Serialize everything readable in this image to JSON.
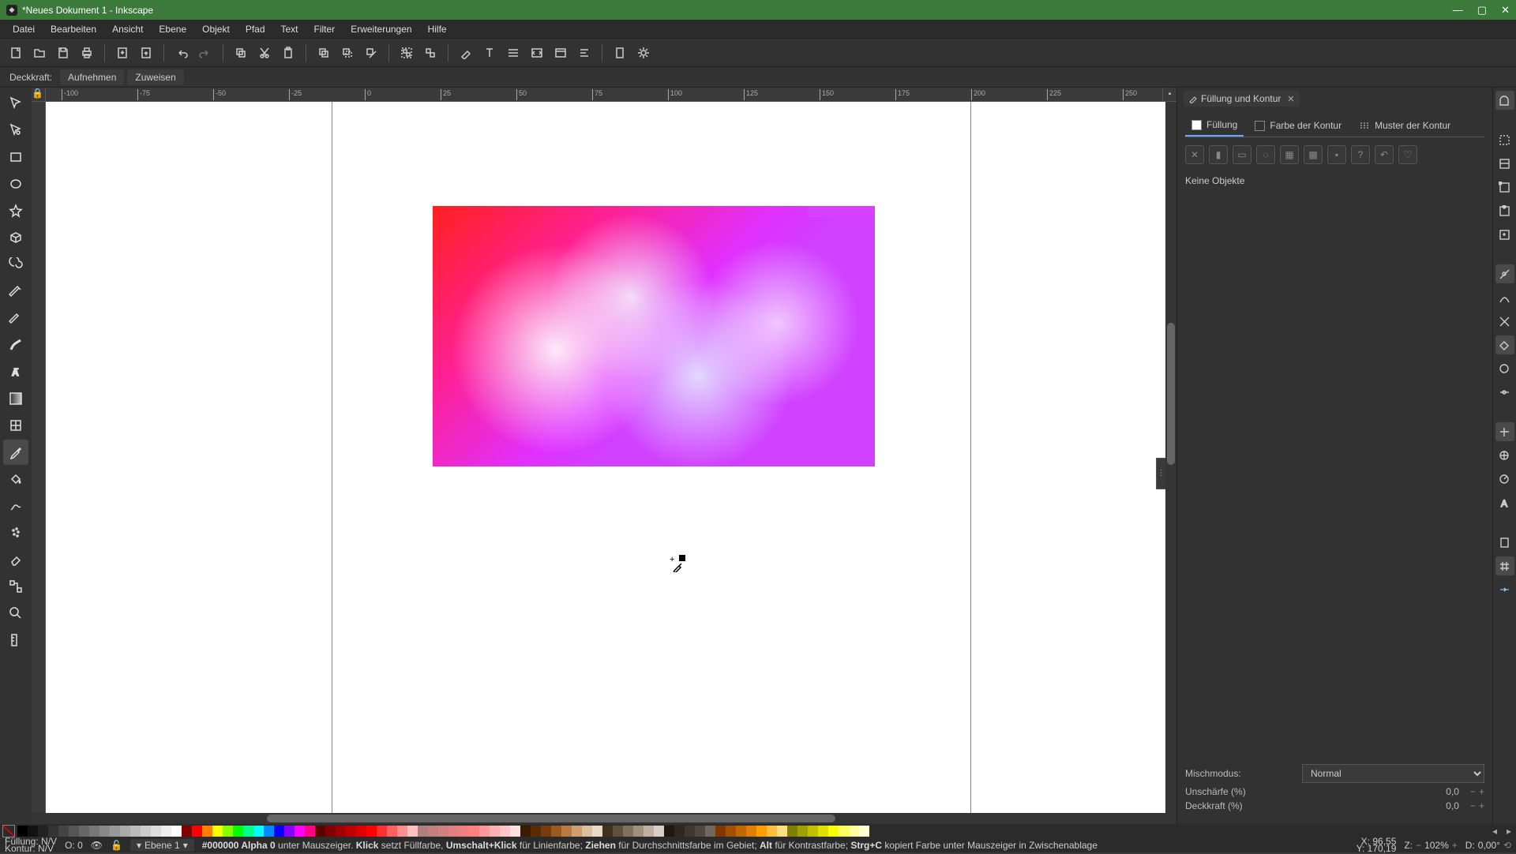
{
  "title": "*Neues Dokument 1 - Inkscape",
  "menu": [
    "Datei",
    "Bearbeiten",
    "Ansicht",
    "Ebene",
    "Objekt",
    "Pfad",
    "Text",
    "Filter",
    "Erweiterungen",
    "Hilfe"
  ],
  "toolopts": {
    "label": "Deckkraft:",
    "pick": "Aufnehmen",
    "assign": "Zuweisen"
  },
  "ruler_h": [
    "-100",
    "-75",
    "-50",
    "-25",
    "0",
    "25",
    "50",
    "75",
    "100",
    "125",
    "150",
    "175",
    "200",
    "225",
    "250"
  ],
  "dock": {
    "tab": "Füllung und Kontur",
    "modes": {
      "fill": "Füllung",
      "stroke": "Farbe der Kontur",
      "pattern": "Muster der Kontur"
    },
    "no_objects": "Keine Objekte",
    "blend_label": "Mischmodus:",
    "blend_value": "Normal",
    "blur_label": "Unschärfe (%)",
    "blur_value": "0,0",
    "opacity_label": "Deckkraft (%)",
    "opacity_value": "0,0"
  },
  "status": {
    "fill_label": "Füllung:",
    "fill_value": "N/V",
    "stroke_label": "Kontur:",
    "stroke_value": "N/V",
    "o_label": "O:",
    "o_value": "0",
    "layer_label": "Ebene 1",
    "hint_color": "#000000 Alpha 0",
    "hint_under": " unter Mauszeiger. ",
    "hint_klick": "Klick",
    "hint_klick_t": " setzt Füllfarbe, ",
    "hint_shift": "Umschalt+Klick",
    "hint_shift_t": " für Linienfarbe; ",
    "hint_drag": "Ziehen",
    "hint_drag_t": " für Durchschnittsfarbe im Gebiet; ",
    "hint_alt": "Alt",
    "hint_alt_t": " für Kontrastfarbe; ",
    "hint_ctrl": "Strg+C",
    "hint_ctrl_t": " kopiert Farbe unter Mauszeiger in Zwischenablage",
    "x_label": "X:",
    "x_value": "96,55",
    "y_label": "Y:",
    "y_value": "170,19",
    "z_label": "Z:",
    "z_value": "102%",
    "d_label": "D:",
    "d_value": "0,00°"
  },
  "palette_blocks": [
    {
      "c": "#000",
      "w": 14
    },
    {
      "c": "#1a1a1a",
      "w": 14
    },
    {
      "c": "#333",
      "w": 14
    },
    {
      "c": "#4d4d4d",
      "w": 14
    },
    {
      "c": "#666",
      "w": 14
    },
    {
      "c": "#808080",
      "w": 14
    },
    {
      "c": "#999",
      "w": 14
    },
    {
      "c": "#b3b3b3",
      "w": 14
    },
    {
      "c": "#ccc",
      "w": 14
    },
    {
      "c": "#e6e6e6",
      "w": 14
    },
    {
      "c": "#fff",
      "w": 14
    },
    {
      "c": "#800000",
      "w": 14
    },
    {
      "c": "#f00",
      "w": 14
    },
    {
      "c": "#ff8000",
      "w": 14
    },
    {
      "c": "#ff0",
      "w": 14
    },
    {
      "c": "#80ff00",
      "w": 14
    },
    {
      "c": "#0f0",
      "w": 14
    },
    {
      "c": "#00ff80",
      "w": 14
    },
    {
      "c": "#0ff",
      "w": 14
    },
    {
      "c": "#0080ff",
      "w": 14
    },
    {
      "c": "#00f",
      "w": 14
    },
    {
      "c": "#8000ff",
      "w": 14
    },
    {
      "c": "#f0f",
      "w": 14
    },
    {
      "c": "#ff0080",
      "w": 14
    }
  ]
}
